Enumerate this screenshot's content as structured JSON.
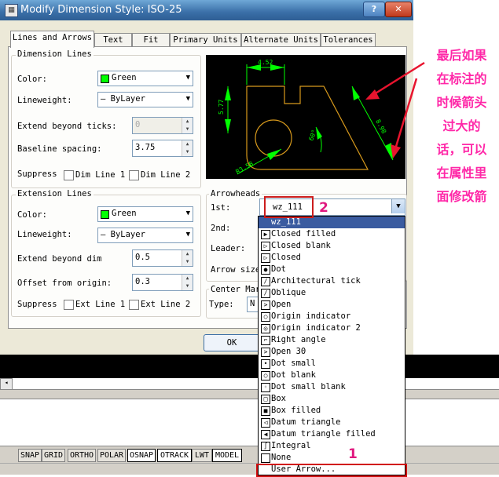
{
  "window": {
    "title": "Modify Dimension Style: ISO-25",
    "help_label": "?",
    "close_label": "✕"
  },
  "tabs": [
    "Lines and Arrows",
    "Text",
    "Fit",
    "Primary Units",
    "Alternate Units",
    "Tolerances"
  ],
  "dimension_lines": {
    "group_title": "Dimension Lines",
    "color_label": "Color:",
    "color_value": "Green",
    "lineweight_label": "Lineweight:",
    "lineweight_value": "— ByLayer",
    "extend_label": "Extend beyond ticks:",
    "extend_value": "0",
    "baseline_label": "Baseline spacing:",
    "baseline_value": "3.75",
    "suppress_label": "Suppress",
    "dim_line1": "Dim Line 1",
    "dim_line2": "Dim Line 2"
  },
  "extension_lines": {
    "group_title": "Extension Lines",
    "color_label": "Color:",
    "color_value": "Green",
    "lineweight_label": "Lineweight:",
    "lineweight_value": "— ByLayer",
    "extend_label": "Extend beyond dim",
    "extend_value": "0.5",
    "offset_label": "Offset from origin:",
    "offset_value": "0.3",
    "suppress_label": "Suppress",
    "ext_line1": "Ext Line 1",
    "ext_line2": "Ext Line 2"
  },
  "preview": {
    "dim_top": "4.52",
    "dim_left": "5.77",
    "dim_right": "8.98",
    "dim_angle": "60°",
    "dim_radius": "R3.58"
  },
  "arrowheads": {
    "group_title": "Arrowheads",
    "first_label": "1st:",
    "first_value": "wz_111",
    "second_label": "2nd:",
    "leader_label": "Leader:",
    "size_label": "Arrow size"
  },
  "center_marks": {
    "group_title": "Center Mar",
    "type_label": "Type:",
    "type_value": "N"
  },
  "ok_label": "OK",
  "arrow_list": [
    {
      "label": "wz_111",
      "icon": "none",
      "selected": true
    },
    {
      "label": "Closed filled",
      "icon": "▶"
    },
    {
      "label": "Closed blank",
      "icon": "▷"
    },
    {
      "label": "Closed",
      "icon": "▷"
    },
    {
      "label": "Dot",
      "icon": "●"
    },
    {
      "label": "Architectural tick",
      "icon": "/"
    },
    {
      "label": "Oblique",
      "icon": "/"
    },
    {
      "label": "Open",
      "icon": ">"
    },
    {
      "label": "Origin indicator",
      "icon": "○"
    },
    {
      "label": "Origin indicator 2",
      "icon": "◎"
    },
    {
      "label": "Right angle",
      "icon": "⌐"
    },
    {
      "label": "Open 30",
      "icon": ">"
    },
    {
      "label": "Dot small",
      "icon": "•"
    },
    {
      "label": "Dot blank",
      "icon": "○"
    },
    {
      "label": "Dot small blank",
      "icon": "◦"
    },
    {
      "label": "Box",
      "icon": "□"
    },
    {
      "label": "Box filled",
      "icon": "■"
    },
    {
      "label": "Datum triangle",
      "icon": "◁"
    },
    {
      "label": "Datum triangle filled",
      "icon": "◀"
    },
    {
      "label": "Integral",
      "icon": "∫"
    },
    {
      "label": "None",
      "icon": ""
    },
    {
      "label": "User Arrow...",
      "icon": "none"
    }
  ],
  "annotations": {
    "num1": "1",
    "num2": "2",
    "note_lines": [
      "最后如果",
      "在标注的",
      "时候箭头",
      "过大的",
      "话，可以",
      "在属性里",
      "面修改箭"
    ]
  },
  "status_bar": [
    "SNAP",
    "GRID",
    "ORTHO",
    "POLAR",
    "OSNAP",
    "OTRACK",
    "LWT",
    "MODEL"
  ],
  "colors": {
    "accent_pink": "#ff28a8",
    "highlight_red": "#d11010",
    "dim_green": "#00ff00",
    "geometry_orange": "#d89a1c"
  }
}
